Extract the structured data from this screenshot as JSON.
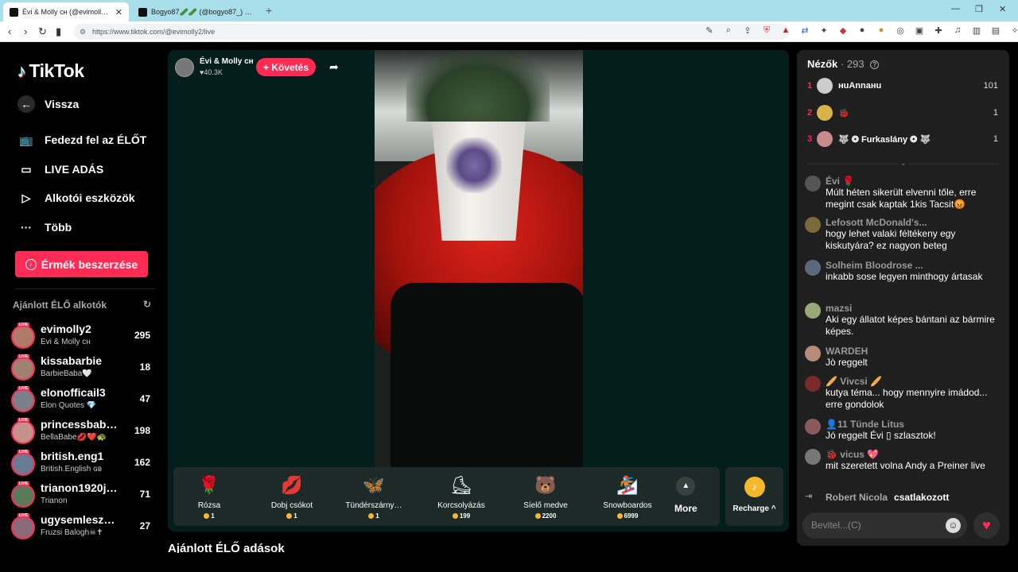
{
  "browser": {
    "tabs": [
      {
        "title": "Évi & Molly ᴄʜ (@evimolly2) |",
        "close": "✕"
      },
      {
        "title": "Bogyo87🥒🥒 (@bogyo87_) ÉLŐ a",
        "close": ""
      }
    ],
    "new_tab": "+",
    "url": "https://www.tiktok.com/@evimolly2/live",
    "window_controls": [
      "—",
      "❐",
      "✕"
    ]
  },
  "sidebar": {
    "logo": "TikTok",
    "back_label": "Vissza",
    "items": [
      {
        "label": "Fedezd fel az ÉLŐT",
        "icon": "tv-icon"
      },
      {
        "label": "LIVE ADÁS",
        "icon": "camera-icon"
      },
      {
        "label": "Alkotói eszközök",
        "icon": "creator-tools-icon"
      },
      {
        "label": "Több",
        "icon": "more-dots-icon"
      }
    ],
    "coins_button": "Érmék beszerzése",
    "recommended_title": "Ajánlott ÉLŐ alkotók",
    "live_badge": "LIVE",
    "creators": [
      {
        "name": "evimolly2",
        "sub": "Évi & Molly ᴄʜ",
        "count": "295"
      },
      {
        "name": "kissabarbie",
        "sub": "BarbieBaba🤍",
        "count": "18"
      },
      {
        "name": "elonofficail3",
        "sub": "Elon Quotes 💎",
        "count": "47"
      },
      {
        "name": "princessbab…",
        "sub": "BellaBabe💋❤️🐢",
        "count": "198"
      },
      {
        "name": "british.eng1",
        "sub": "British.English ɢʙ",
        "count": "162"
      },
      {
        "name": "trianon1920j…",
        "sub": "Trianon",
        "count": "71"
      },
      {
        "name": "ugysemlesze…",
        "sub": "Fruzsi Balogh☠✝",
        "count": "27"
      }
    ]
  },
  "stream": {
    "host_name": "Évi & Molly ᴄʜ",
    "host_likes": "♥40.3K",
    "follow_label": "+ Követés",
    "gifts": [
      {
        "name": "Rózsa",
        "price": "1",
        "icon": "🌹"
      },
      {
        "name": "Dobj csókot",
        "price": "1",
        "icon": "💋"
      },
      {
        "name": "Tündérszárny…",
        "price": "1",
        "icon": "🦋"
      },
      {
        "name": "Korcsolyázás",
        "price": "199",
        "icon": "⛸"
      },
      {
        "name": "Síelő medve",
        "price": "2200",
        "icon": "🐻"
      },
      {
        "name": "Snowboardos",
        "price": "6999",
        "icon": "🏂"
      }
    ],
    "more_label": "More",
    "recharge_label": "Recharge ^"
  },
  "below": {
    "title": "Ajánlott ÉLŐ adások"
  },
  "chat": {
    "viewers_label": "Nézők",
    "viewers_count": "· 293",
    "top_viewers": [
      {
        "rank": "1",
        "name": "нuAnnaнu",
        "score": "101"
      },
      {
        "rank": "2",
        "name": "🐞",
        "score": "1"
      },
      {
        "rank": "3",
        "name": "🐺 ❂ Furkaslány ❂ 🐺",
        "score": "1"
      }
    ],
    "messages": [
      {
        "user": "Évi 🌹",
        "text": "Múlt héten sikerült elvenni tőle, erre megint csak kaptak 1kis Tacsit😡"
      },
      {
        "user": "Lefosott McDonald's...",
        "text": "hogy lehet valaki féltékeny egy kiskutyára? ez nagyon beteg"
      },
      {
        "user": "Solheim Bloodrose ...",
        "text": "inkabb sose legyen minthogy ártasak"
      },
      {
        "user": "mazsi",
        "text": "Aki egy állatot képes bántani az bármire képes."
      },
      {
        "user": "WARDEH",
        "text": "Jò reggelt"
      },
      {
        "user": "🥖 Vivcsi 🥖",
        "text": "kutya téma... hogy mennyire imádod... erre gondolok"
      },
      {
        "user": "👤11 Tünde Litus",
        "text": "Jó reggelt Évi ▯ szlasztok!"
      },
      {
        "user": "🐞 vicus 💖",
        "text": "mit szeretett volna Andy a Preiner live"
      }
    ],
    "joined_user": "Robert Nicola",
    "joined_text": "csatlakozott",
    "input_placeholder": "Bevitel...(C)"
  }
}
